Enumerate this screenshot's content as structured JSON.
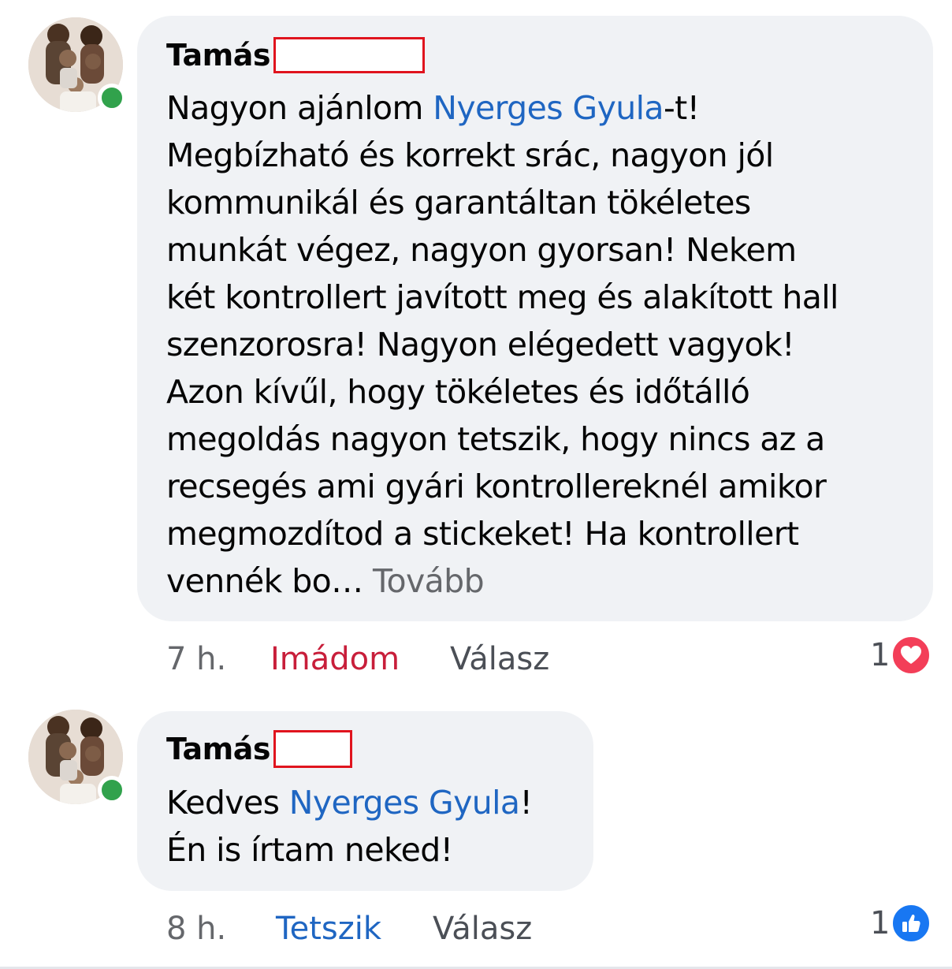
{
  "comments": [
    {
      "author": "Tamás",
      "text_parts": {
        "p1": "Nagyon ajánlom ",
        "mention": "Nyerges Gyula",
        "p2": "-t!\nMegbízható és korrekt srác, nagyon jól\nkommunikál és garantáltan tökéletes\nmunkát végez, nagyon gyorsan! Nekem\nkét kontrollert javított meg és alakított hall\nszenzorosra! Nagyon elégedett vagyok!\nAzon kívűl, hogy tökéletes és időtálló\nmegoldás nagyon tetszik, hogy nincs az a\nrecsegés ami gyári kontrollereknél amikor\nmegmozdítod a stickeket! Ha kontrollert\nvennék bo… ",
        "more": "Tovább"
      },
      "time": "7 h.",
      "reaction_label": "Imádom",
      "reply_label": "Válasz",
      "reaction_count": "1",
      "reaction_icon": "heart-icon"
    },
    {
      "author": "Tamás",
      "text_parts": {
        "p1": "Kedves ",
        "mention": "Nyerges Gyula",
        "p2": "!\nÉn is írtam neked!"
      },
      "time": "8 h.",
      "reaction_label": "Tetszik",
      "reply_label": "Válasz",
      "reaction_count": "1",
      "reaction_icon": "like-icon"
    }
  ],
  "colors": {
    "bubble": "#f0f2f5",
    "mention": "#1f66c2",
    "love": "#c81e3a",
    "like": "#1877f2",
    "online": "#31a24c",
    "redaction": "#e0141e"
  }
}
